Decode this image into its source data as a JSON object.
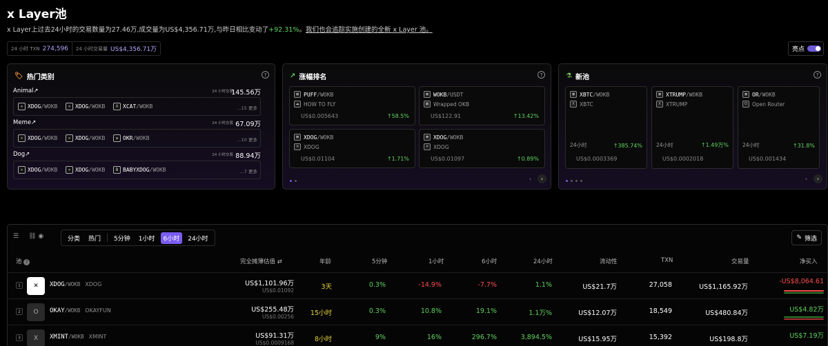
{
  "header": {
    "title": "x Layer池",
    "desc_a": "x Layer上过去24小时的交易数量为27.46万,成交量为US$4,356.71万,与昨日相比变动了",
    "desc_change": "+92.31%",
    "desc_b": "。",
    "desc_link": "我们也会追踪实施创建的全新 x Layer 池。",
    "stat_txn_label": "24 小时 TXN",
    "stat_txn_value": "274,596",
    "stat_vol_label": "24 小时交易量",
    "stat_vol_value": "US$4,356.71万",
    "highlight_label": "亮点"
  },
  "colors": {
    "accent": "#7a5cf0",
    "up": "#5fd35f",
    "down": "#ff4b4b"
  },
  "hot": {
    "title": "热门类别",
    "categories": [
      {
        "name": "Animal",
        "arrow": "↗",
        "stat_label": "24 小时交易",
        "stat_value": "145.56万",
        "chips": [
          {
            "base": "XDOG",
            "quote": "/WOKB"
          },
          {
            "base": "XDOG",
            "quote": "/WOKB"
          },
          {
            "base": "XCAT",
            "quote": "/WOKB"
          }
        ],
        "more": "...15 更多"
      },
      {
        "name": "Meme",
        "arrow": "↗",
        "stat_label": "24 小时交易",
        "stat_value": "67.09万",
        "chips": [
          {
            "base": "XDOG",
            "quote": "/WOKB"
          },
          {
            "base": "XDOG",
            "quote": "/WOKB"
          },
          {
            "base": "OKR",
            "quote": "/WOKB"
          }
        ],
        "more": "...10 更多"
      },
      {
        "name": "Dog",
        "arrow": "↗",
        "stat_label": "24 小时交易",
        "stat_value": "88.94万",
        "chips": [
          {
            "base": "XDOG",
            "quote": "/WOKB"
          },
          {
            "base": "XDOG",
            "quote": "/WOKB"
          },
          {
            "base": "BABYXDOG",
            "quote": "/WOKB"
          }
        ],
        "more": "...7 更多"
      }
    ]
  },
  "gainers": {
    "title": "涨幅排名",
    "tiles": [
      {
        "base": "PUFF",
        "quote": "/WOKB",
        "name": "HOW TO FLY",
        "price": "US$0.005643",
        "change": "58.5%"
      },
      {
        "base": "WOKB",
        "quote": "/USDT",
        "name": "Wrapped OKB",
        "price": "US$122.91",
        "change": "13.42%"
      },
      {
        "base": "XDOG",
        "quote": "/WOKB",
        "name": "XDOG",
        "price": "US$0.01104",
        "change": "1.71%"
      },
      {
        "base": "XDOG",
        "quote": "/WOKB",
        "name": "XDOG",
        "price": "US$0.01097",
        "change": "0.89%"
      }
    ]
  },
  "newpools": {
    "title": "新池",
    "tiles": [
      {
        "base": "XBTC",
        "quote": "/WOKB",
        "name": "XBTC",
        "label": "24小时",
        "change": "385.74%",
        "price": "US$0.0003369"
      },
      {
        "base": "XTRUMP",
        "quote": "/WOKB",
        "name": "XTRUMP",
        "label": "24小时",
        "change": "1.49万%",
        "price": "US$0.0002018"
      },
      {
        "base": "OR",
        "quote": "/WOKB",
        "name": "Open Router",
        "label": "24小时",
        "change": "31.8%",
        "price": "US$0.001434"
      }
    ]
  },
  "toolbar": {
    "seg_label": "分类",
    "seg_hot": "热门",
    "seg_5m": "5分钟",
    "seg_1h": "1小时",
    "seg_6h": "6小时",
    "seg_24h": "24小时",
    "filter": "筛选"
  },
  "table": {
    "headers": {
      "pool": "池",
      "fdv": "完全摊薄估值",
      "age": "年龄",
      "m5": "5分钟",
      "h1": "1小时",
      "h6": "6小时",
      "h24": "24小时",
      "liq": "流动性",
      "txn": "TXN",
      "vol": "交易量",
      "net": "净买入"
    },
    "rows": [
      {
        "rank": "1",
        "base": "XDOG",
        "quote": "/WOKB",
        "ticker": "XDOG",
        "fdv": "US$1,101.96万",
        "price": "US$0.01092",
        "age": "3天",
        "m5": "0.3%",
        "h1": "-14.9%",
        "h6": "-7.7%",
        "h24": "1.1%",
        "liq": "US$21.7万",
        "txn": "27,058",
        "vol": "US$1,165.92万",
        "net": "-US$8,064.61"
      },
      {
        "rank": "2",
        "base": "OKAY",
        "quote": "/WOKB",
        "ticker": "OKAYFUN",
        "fdv": "US$255.48万",
        "price": "US$0.00256",
        "age": "15小时",
        "m5": "0.3%",
        "h1": "10.8%",
        "h6": "19.1%",
        "h24": "1.1万%",
        "liq": "US$12.07万",
        "txn": "18,549",
        "vol": "US$480.84万",
        "net": "US$4.82万"
      },
      {
        "rank": "3",
        "base": "XMINT",
        "quote": "/WOKB",
        "ticker": "XMINT",
        "fdv": "US$91.31万",
        "price": "US$0.0009168",
        "age": "8小时",
        "m5": "9%",
        "h1": "16%",
        "h6": "296.7%",
        "h24": "3,894.5%",
        "liq": "US$15.95万",
        "txn": "15,392",
        "vol": "US$198.8万",
        "net": "US$7.19万"
      }
    ]
  }
}
